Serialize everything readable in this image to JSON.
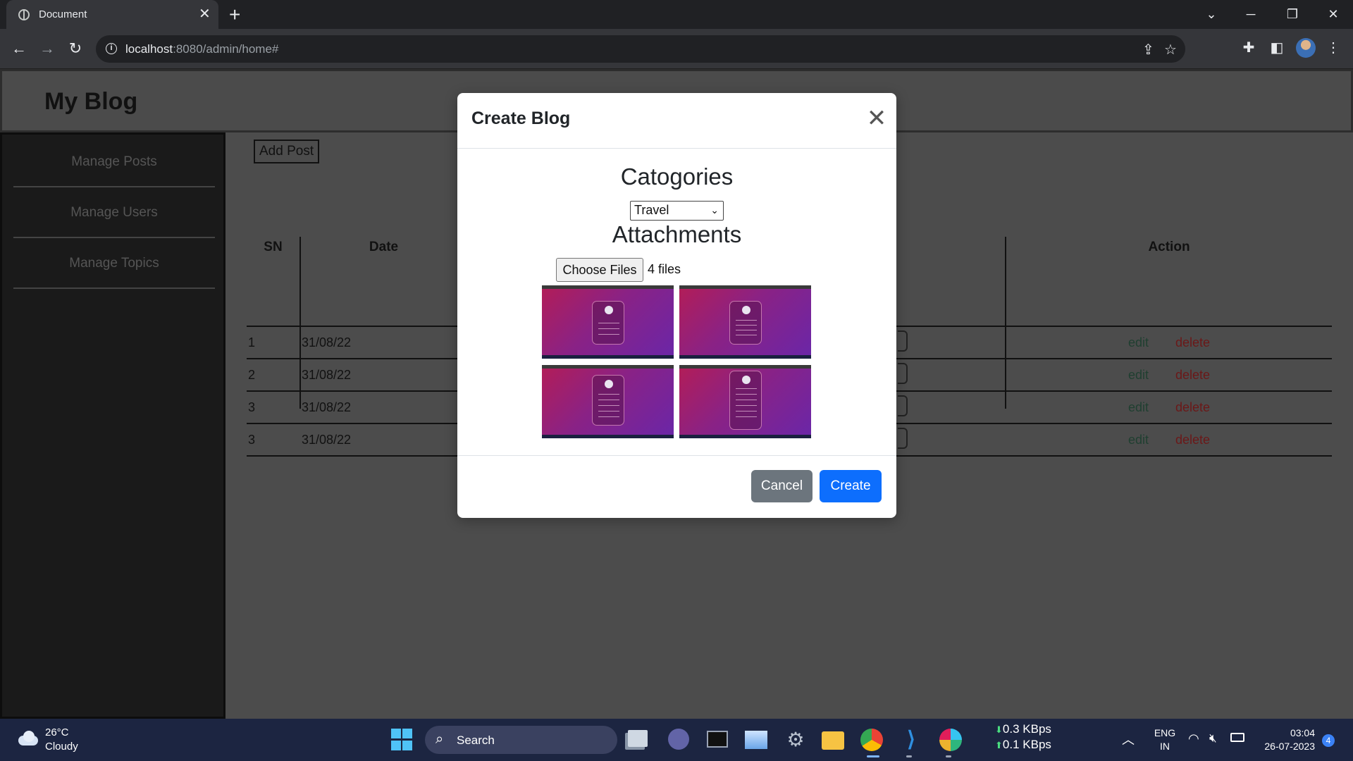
{
  "browser": {
    "tab_title": "Document",
    "url_host": "localhost",
    "url_rest": ":8080/admin/home#"
  },
  "site": {
    "title": "My Blog",
    "sidebar": [
      {
        "label": "Manage Posts"
      },
      {
        "label": "Manage Users"
      },
      {
        "label": "Manage Topics"
      }
    ],
    "add_post_label": "Add Post"
  },
  "table": {
    "headers": {
      "sn": "SN",
      "date": "Date",
      "action": "Action"
    },
    "rows": [
      {
        "sn": "1",
        "date": "31/08/22",
        "edit": "edit",
        "delete": "delete"
      },
      {
        "sn": "2",
        "date": "31/08/22",
        "edit": "edit",
        "delete": "delete"
      },
      {
        "sn": "3",
        "date": "31/08/22",
        "edit": "edit",
        "delete": "delete"
      },
      {
        "sn": "3",
        "date": "31/08/22",
        "edit": "edit",
        "delete": "delete"
      }
    ]
  },
  "modal": {
    "title": "Create Blog",
    "categories_heading": "Catogories",
    "category_selected": "Travel",
    "attachments_heading": "Attachments",
    "choose_files_label": "Choose Files",
    "file_count": "4 files",
    "cancel_label": "Cancel",
    "create_label": "Create"
  },
  "taskbar": {
    "weather_temp": "26°C",
    "weather_desc": "Cloudy",
    "search_label": "Search",
    "net_down": "0.3 KBps",
    "net_up": "0.1 KBps",
    "lang_top": "ENG",
    "lang_bottom": "IN",
    "time": "03:04",
    "date": "26-07-2023",
    "notification_count": "4"
  },
  "colors": {
    "primary_button": "#0d6efd",
    "secondary_button": "#6c757d",
    "edit_link": "#1f3f30",
    "delete_link": "#6b1818"
  }
}
